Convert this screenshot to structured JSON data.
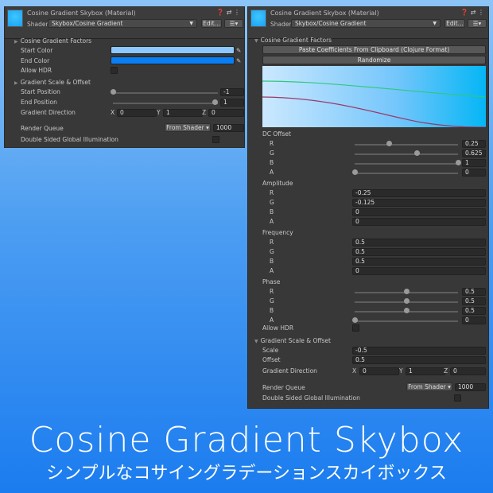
{
  "left": {
    "title": "Cosine Gradient Skybox (Material)",
    "shader_label": "Shader",
    "shader": "Skybox/Cosine Gradient",
    "edit": "Edit...",
    "factors": "Cosine Gradient Factors",
    "start_color": "Start Color",
    "start_color_value": "#8cc8ff",
    "end_color": "End Color",
    "end_color_value": "#0a7ef5",
    "allow_hdr": "Allow HDR",
    "scale_offset": "Gradient Scale & Offset",
    "start_pos": "Start Position",
    "start_pos_value": "-1",
    "end_pos": "End Position",
    "end_pos_value": "1",
    "grad_dir": "Gradient Direction",
    "x": "X",
    "xv": "0",
    "y": "Y",
    "yv": "1",
    "z": "Z",
    "zv": "0",
    "render_queue": "Render Queue",
    "rq_mode": "From Shader",
    "rq_value": "1000",
    "double_sided": "Double Sided Global Illumination"
  },
  "right": {
    "title": "Cosine Gradient Skybox (Material)",
    "shader_label": "Shader",
    "shader": "Skybox/Cosine Gradient",
    "edit": "Edit...",
    "factors": "Cosine Gradient Factors",
    "paste": "Paste Coefficients From Clipboard (Clojure Format)",
    "randomize": "Randomize",
    "groups": [
      {
        "label": "DC Offset",
        "slider": true,
        "items": [
          {
            "c": "R",
            "v": "0.25",
            "f": 0.33
          },
          {
            "c": "G",
            "v": "0.625",
            "f": 0.6
          },
          {
            "c": "B",
            "v": "1",
            "f": 1
          },
          {
            "c": "A",
            "v": "0",
            "f": 0
          }
        ]
      },
      {
        "label": "Amplitude",
        "slider": false,
        "items": [
          {
            "c": "R",
            "v": "-0.25"
          },
          {
            "c": "G",
            "v": "-0.125"
          },
          {
            "c": "B",
            "v": "0"
          },
          {
            "c": "A",
            "v": "0"
          }
        ]
      },
      {
        "label": "Frequency",
        "slider": false,
        "items": [
          {
            "c": "R",
            "v": "0.5"
          },
          {
            "c": "G",
            "v": "0.5"
          },
          {
            "c": "B",
            "v": "0.5"
          },
          {
            "c": "A",
            "v": "0"
          }
        ]
      },
      {
        "label": "Phase",
        "slider": true,
        "items": [
          {
            "c": "R",
            "v": "0.5",
            "f": 0.5
          },
          {
            "c": "G",
            "v": "0.5",
            "f": 0.5
          },
          {
            "c": "B",
            "v": "0.5",
            "f": 0.5
          },
          {
            "c": "A",
            "v": "0",
            "f": 0
          }
        ]
      }
    ],
    "allow_hdr": "Allow HDR",
    "scale_offset": "Gradient Scale & Offset",
    "scale": "Scale",
    "scale_value": "-0.5",
    "offset": "Offset",
    "offset_value": "0.5",
    "grad_dir": "Gradient Direction",
    "x": "X",
    "xv": "0",
    "y": "Y",
    "yv": "1",
    "z": "Z",
    "zv": "0",
    "render_queue": "Render Queue",
    "rq_mode": "From Shader",
    "rq_value": "1000",
    "double_sided": "Double Sided Global Illumination"
  },
  "banner": {
    "title": "Cosine Gradient Skybox",
    "subtitle": "シンプルなコサイングラデーションスカイボックス"
  }
}
